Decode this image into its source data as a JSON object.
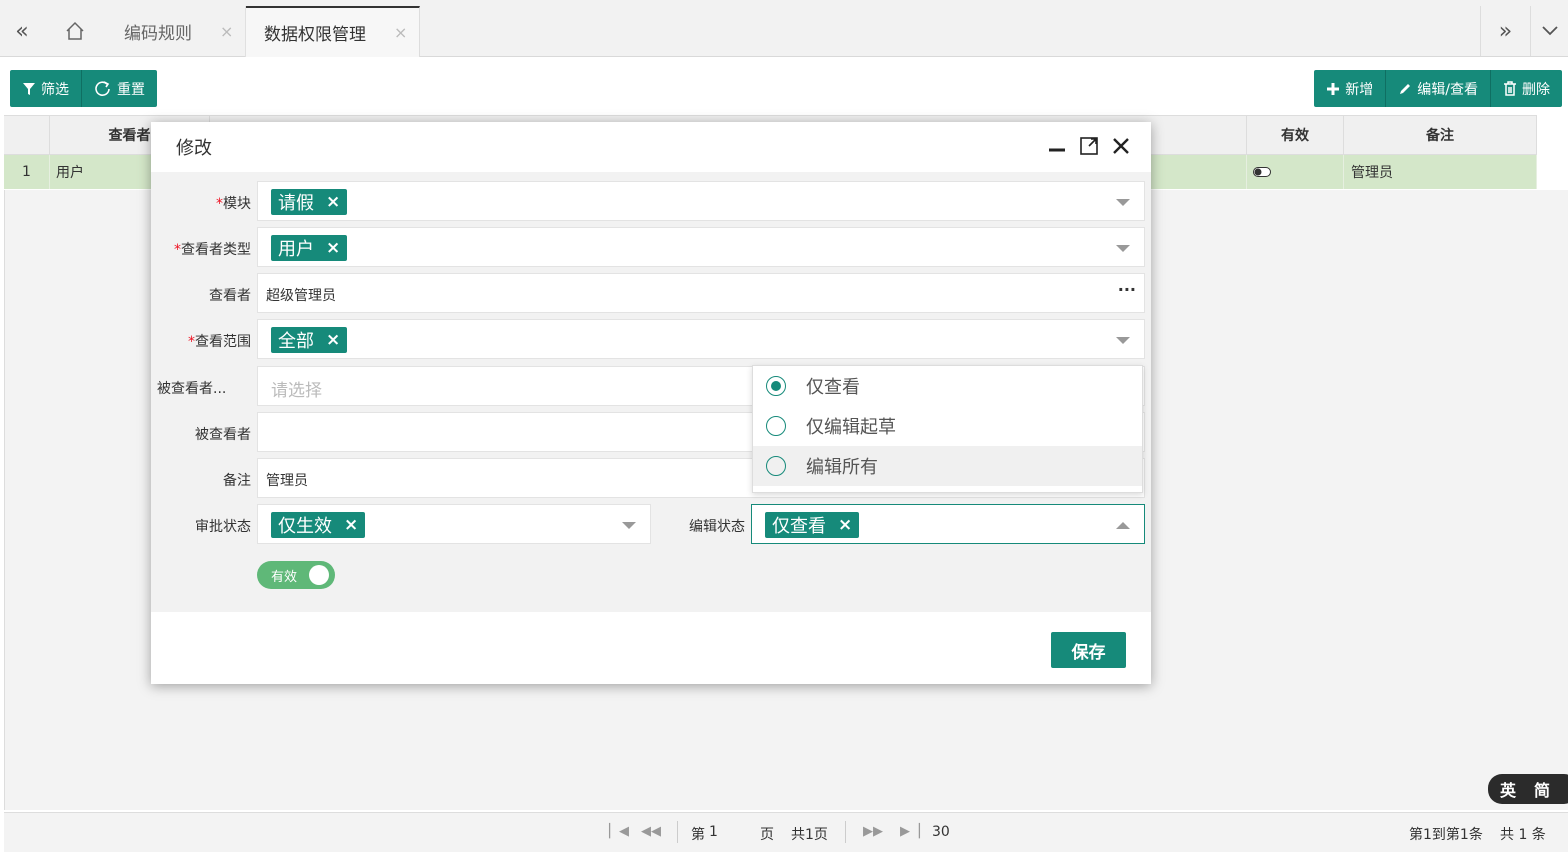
{
  "tabs": {
    "tab1": "编码规则",
    "tab2": "数据权限管理",
    "close": "×"
  },
  "toolbar": {
    "filter": "筛选",
    "reset": "重置",
    "add": "新增",
    "edit": "编辑/查看",
    "delete": "删除"
  },
  "grid": {
    "headers": {
      "viewer": "查看者",
      "valid": "有效",
      "remark": "备注"
    },
    "row": {
      "index": "1",
      "viewer": "用户",
      "remark": "管理员"
    }
  },
  "modal": {
    "title": "修改",
    "fields": {
      "module": {
        "label": "模块",
        "tag": "请假"
      },
      "viewer_type": {
        "label": "查看者类型",
        "tag": "用户"
      },
      "viewer": {
        "label": "查看者",
        "value": "超级管理员",
        "more": "···"
      },
      "scope": {
        "label": "查看范围",
        "tag": "全部"
      },
      "viewed_type": {
        "label": "被查看者...",
        "placeholder": "请选择"
      },
      "viewed": {
        "label": "被查看者",
        "value": ""
      },
      "remark": {
        "label": "备注",
        "value": "管理员"
      },
      "approval": {
        "label": "审批状态",
        "tag": "仅生效"
      },
      "edit_state": {
        "label": "编辑状态",
        "tag": "仅查看"
      }
    },
    "toggle": "有效",
    "save": "保存",
    "required_mark": "*",
    "tag_close": "×"
  },
  "dropdown": {
    "options": [
      "仅查看",
      "仅编辑起草",
      "编辑所有"
    ],
    "selected": "仅查看"
  },
  "pager": {
    "page_prefix": "第",
    "page": "1",
    "page_suffix": "页",
    "total_pages": "共1页",
    "page_size": "30",
    "range": "第1到第1条",
    "total": "共 1 条"
  },
  "ime": {
    "lang": "英",
    "mode": "简"
  },
  "colors": {
    "accent": "#168a7a",
    "selected_row": "#d4e7c9",
    "toggle_on": "#5fb878"
  }
}
